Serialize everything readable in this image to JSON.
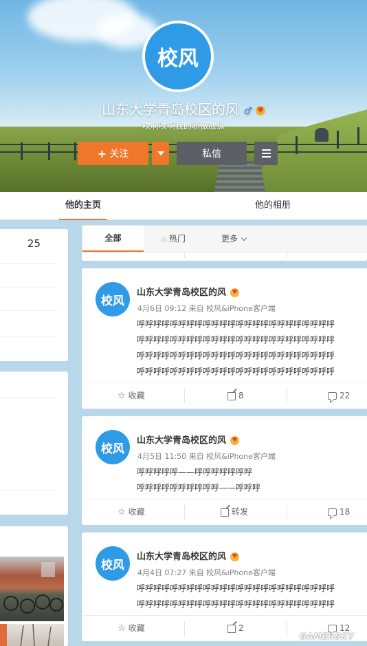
{
  "profile": {
    "avatar_text": "校风",
    "name": "山东大学青岛校区的风",
    "gender_icon": "male-icon",
    "badge_icon": "vip-emoji-icon",
    "signature": "吹啊吹啊我的骄傲放纵",
    "follow_label": "关注",
    "message_label": "私信"
  },
  "tabs": {
    "home": "他的主页",
    "album": "他的相册"
  },
  "sidebar": {
    "count": "25"
  },
  "filter": {
    "all": "全部",
    "hot": "热门",
    "more": "更多"
  },
  "posts": [
    {
      "avatar_text": "校风",
      "name": "山东大学青岛校区的风",
      "meta": "4月6日 09:12 来自 校风&iPhone客户端",
      "lines": [
        "呼呼呼呼呼呼呼呼呼呼呼呼呼呼呼呼呼呼呼呼呼呼呼呼",
        "呼呼呼呼呼呼呼呼呼呼呼呼呼呼呼呼呼呼呼呼呼呼呼呼",
        "呼呼呼呼呼呼呼呼呼呼呼呼呼呼呼呼呼呼呼呼呼呼呼呼",
        "呼呼呼呼呼呼呼呼呼呼呼呼呼呼呼呼呼呼呼呼呼呼呼呼"
      ],
      "fav": "收藏",
      "repost": "8",
      "comments": "22"
    },
    {
      "avatar_text": "校风",
      "name": "山东大学青岛校区的风",
      "meta": "4月5日 11:50 来自 校风&iPhone客户端",
      "lines": [
        "呼呼呼呼呼——呼呼呼呼呼呼呼",
        "呼呼呼呼呼呼呼呼呼呼——呼呼呼"
      ],
      "fav": "收藏",
      "repost": "转发",
      "comments": "18"
    },
    {
      "avatar_text": "校风",
      "name": "山东大学青岛校区的风",
      "meta": "4月4日 07:27 来自 校风&iPhone客户端",
      "lines": [
        "呼呼呼呼呼呼呼呼呼呼呼呼呼呼呼呼呼呼呼呼呼呼呼呼",
        "呼呼呼呼呼呼呼呼呼呼呼呼呼呼呼呼呼呼呼呼呼呼呼呼"
      ],
      "fav": "收藏",
      "repost": "2",
      "comments": "12"
    }
  ],
  "watermark": "GAMERSKY"
}
